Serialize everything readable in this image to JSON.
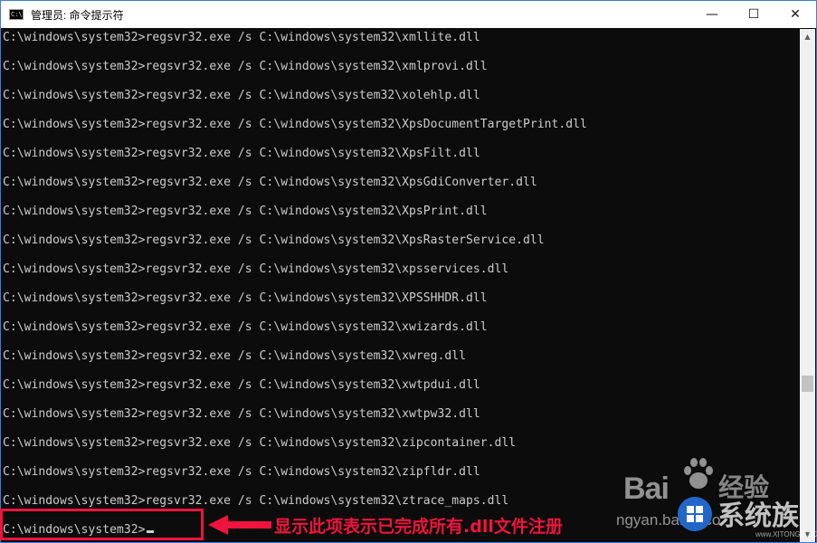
{
  "window": {
    "title": "管理员: 命令提示符",
    "icon": "cmd-icon",
    "icon_glyph": "C:\\",
    "controls": {
      "minimize": "—",
      "maximize": "☐",
      "close": "✕"
    }
  },
  "console": {
    "lines": [
      "C:\\windows\\system32>regsvr32.exe /s C:\\windows\\system32\\xmllite.dll",
      "C:\\windows\\system32>regsvr32.exe /s C:\\windows\\system32\\xmlprovi.dll",
      "C:\\windows\\system32>regsvr32.exe /s C:\\windows\\system32\\xolehlp.dll",
      "C:\\windows\\system32>regsvr32.exe /s C:\\windows\\system32\\XpsDocumentTargetPrint.dll",
      "C:\\windows\\system32>regsvr32.exe /s C:\\windows\\system32\\XpsFilt.dll",
      "C:\\windows\\system32>regsvr32.exe /s C:\\windows\\system32\\XpsGdiConverter.dll",
      "C:\\windows\\system32>regsvr32.exe /s C:\\windows\\system32\\XpsPrint.dll",
      "C:\\windows\\system32>regsvr32.exe /s C:\\windows\\system32\\XpsRasterService.dll",
      "C:\\windows\\system32>regsvr32.exe /s C:\\windows\\system32\\xpsservices.dll",
      "C:\\windows\\system32>regsvr32.exe /s C:\\windows\\system32\\XPSSHHDR.dll",
      "C:\\windows\\system32>regsvr32.exe /s C:\\windows\\system32\\xwizards.dll",
      "C:\\windows\\system32>regsvr32.exe /s C:\\windows\\system32\\xwreg.dll",
      "C:\\windows\\system32>regsvr32.exe /s C:\\windows\\system32\\xwtpdui.dll",
      "C:\\windows\\system32>regsvr32.exe /s C:\\windows\\system32\\xwtpw32.dll",
      "C:\\windows\\system32>regsvr32.exe /s C:\\windows\\system32\\zipcontainer.dll",
      "C:\\windows\\system32>regsvr32.exe /s C:\\windows\\system32\\zipfldr.dll",
      "C:\\windows\\system32>regsvr32.exe /s C:\\windows\\system32\\ztrace_maps.dll"
    ],
    "prompt": "C:\\windows\\system32>"
  },
  "scrollbar": {
    "up_arrow": "▲",
    "down_arrow": "▼"
  },
  "annotation": {
    "text": "显示此项表示已完成所有.dll文件注册",
    "color": "#f0143c"
  },
  "watermark": {
    "baidu": "Bai",
    "jingyan": "经验",
    "url_partial": "ngyan.baidu.co",
    "xitongzu": "系统族",
    "domain": "www.XITONGZU.COM"
  },
  "colors": {
    "console_bg": "#0c0c0c",
    "console_text": "#cccccc",
    "window_border": "#3b7fd6",
    "annotation_red": "#f0143c"
  }
}
